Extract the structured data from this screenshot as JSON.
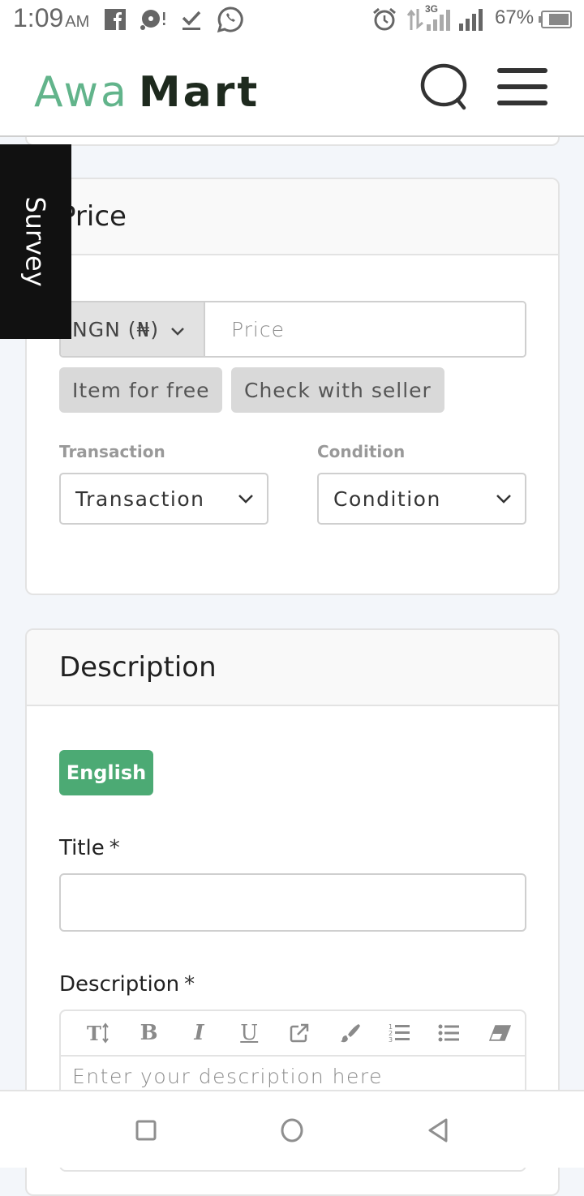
{
  "status_bar": {
    "time": "1:09",
    "ampm": "AM",
    "left_icons": [
      "facebook-icon",
      "music-icon",
      "download-done-icon",
      "whatsapp-icon"
    ],
    "right_icons": [
      "alarm-icon",
      "data-arrows-icon",
      "signal-3g-icon",
      "signal-icon",
      "battery-icon"
    ],
    "network": "3G",
    "battery": "67%"
  },
  "header": {
    "logo_part1": "Awa",
    "logo_part2": "Mart",
    "search_icon": "search-icon",
    "menu_icon": "hamburger-menu-icon"
  },
  "colors": {
    "brand_green": "#62b48b",
    "button_green": "#4caa74",
    "page_bg": "#f3f6fa"
  },
  "survey_tab": {
    "label": "Survey"
  },
  "price_card": {
    "title": "Price",
    "currency": "NGN (₦)",
    "price_placeholder": "Price",
    "chips": [
      "Item for free",
      "Check with seller"
    ],
    "transaction_label": "Transaction",
    "transaction_value": "Transaction",
    "condition_label": "Condition",
    "condition_value": "Condition"
  },
  "description_card": {
    "title": "Description",
    "language_button": "English",
    "title_label": "Title",
    "required_mark": "*",
    "title_value": "",
    "description_label": "Description",
    "toolbar": [
      "text-size",
      "bold",
      "italic",
      "underline",
      "link",
      "color-brush",
      "ordered-list",
      "unordered-list",
      "eraser"
    ],
    "description_placeholder": "Enter your description here"
  },
  "nav_bar": {
    "buttons": [
      "recent-apps",
      "home",
      "back"
    ]
  }
}
